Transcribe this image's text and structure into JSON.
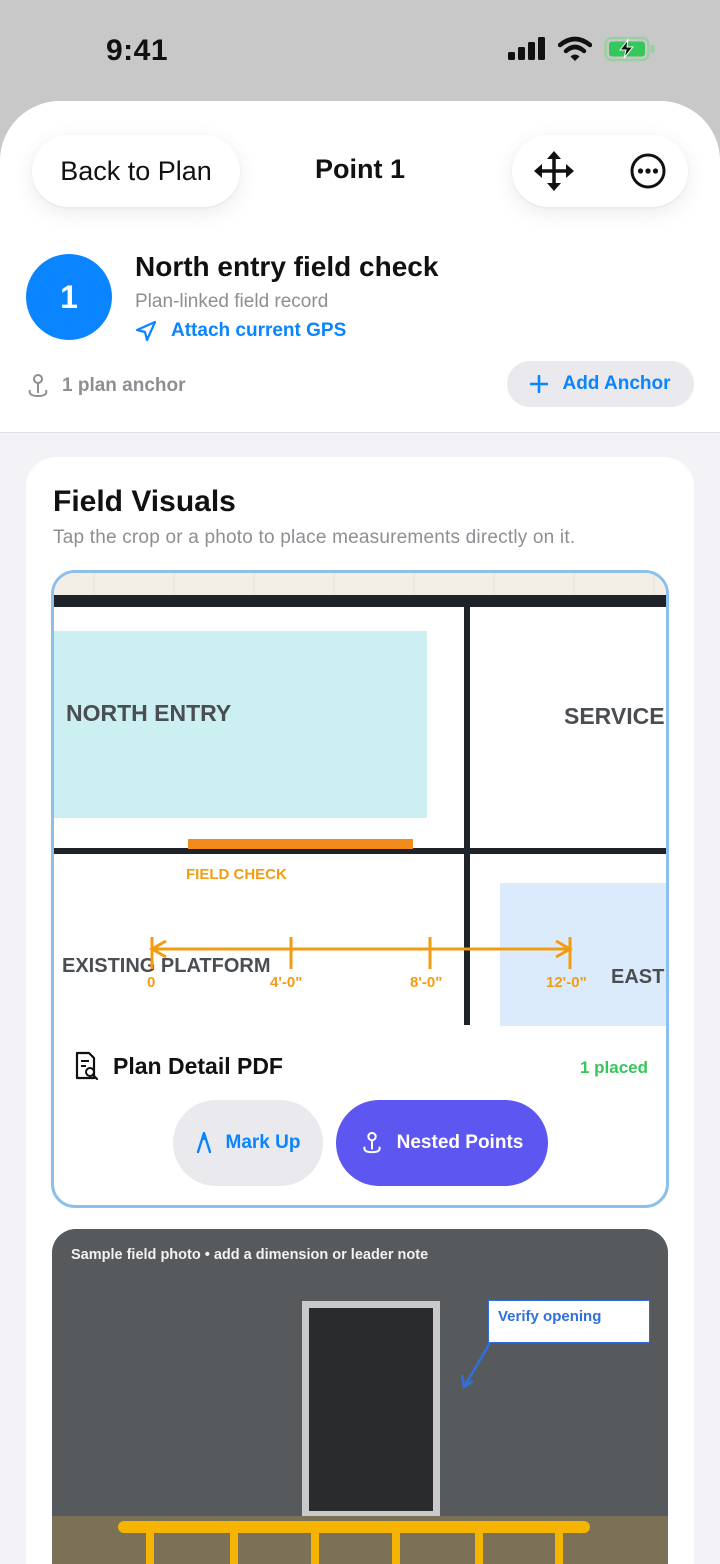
{
  "status_bar": {
    "time": "9:41"
  },
  "nav": {
    "back_label": "Back to Plan",
    "title": "Point 1"
  },
  "point": {
    "number": "1",
    "title": "North entry field check",
    "subtitle": "Plan-linked field record",
    "gps_label": "Attach current GPS",
    "anchor_count_label": "1 plan anchor",
    "add_anchor_label": "Add Anchor"
  },
  "field_visuals": {
    "title": "Field Visuals",
    "subtitle": "Tap the crop or a photo to place measurements directly on it.",
    "plan_crop": {
      "labels": {
        "north_entry": "NORTH ENTRY",
        "service": "SERVICE",
        "field_check": "FIELD CHECK",
        "existing_platform": "EXISTING PLATFORM",
        "east": "EAST"
      },
      "dimension_ticks": [
        "0",
        "4'-0\"",
        "8'-0\"",
        "12'-0\""
      ],
      "document_title": "Plan Detail PDF",
      "placed_badge": "1 placed",
      "markup_label": "Mark Up",
      "nested_points_label": "Nested Points"
    },
    "photo": {
      "caption": "Sample field photo • add a dimension or leader note",
      "note_label": "Verify opening"
    }
  },
  "colors": {
    "accent_blue": "#0a84ff",
    "nested_purple": "#5e56f0",
    "placed_green": "#34c759",
    "dimension_orange": "#f39c12",
    "plan_cyan": "#ccf0f2",
    "plan_light_blue": "#dcebfb"
  },
  "icons": [
    "move-arrows-icon",
    "more-ellipsis-icon",
    "location-arrow-icon",
    "pin-anchor-icon",
    "plus-icon",
    "document-search-icon",
    "pen-nib-icon"
  ]
}
